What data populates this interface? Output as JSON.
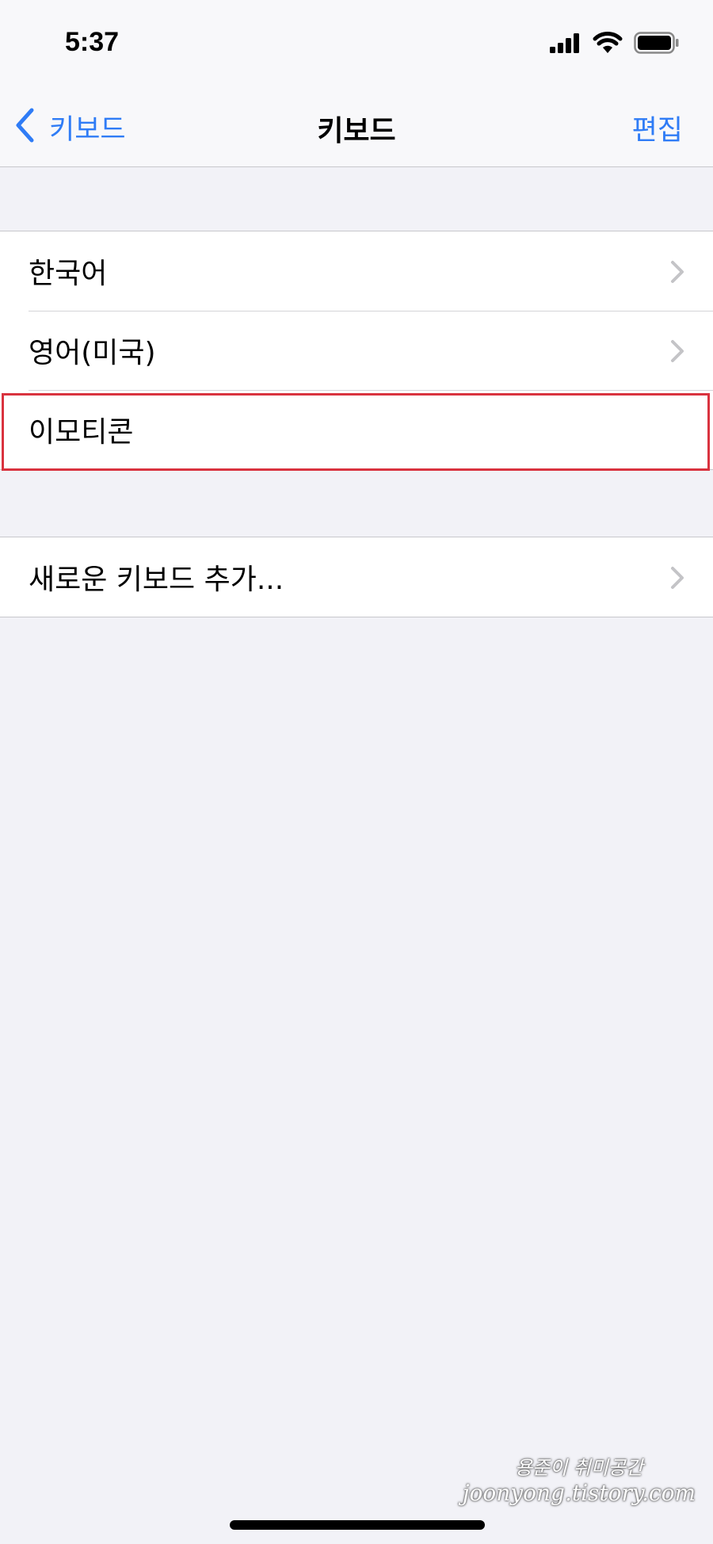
{
  "status_bar": {
    "time": "5:37",
    "icons": [
      "cellular-signal-icon",
      "wifi-icon",
      "battery-icon"
    ]
  },
  "nav": {
    "back_label": "키보드",
    "back_icon": "chevron-left-icon",
    "title": "키보드",
    "edit_label": "편집"
  },
  "keyboards": {
    "items": [
      {
        "label": "한국어",
        "chevron": true
      },
      {
        "label": "영어(미국)",
        "chevron": true
      },
      {
        "label": "이모티콘",
        "chevron": false,
        "highlighted": true
      }
    ]
  },
  "add_keyboard": {
    "label": "새로운 키보드 추가..."
  },
  "watermark": {
    "line1": "용준이 취미공간",
    "line2": "joonyong.tistory.com"
  },
  "colors": {
    "accent": "#2f7cf6",
    "highlight_border": "#d9333f",
    "background": "#f2f2f7"
  }
}
